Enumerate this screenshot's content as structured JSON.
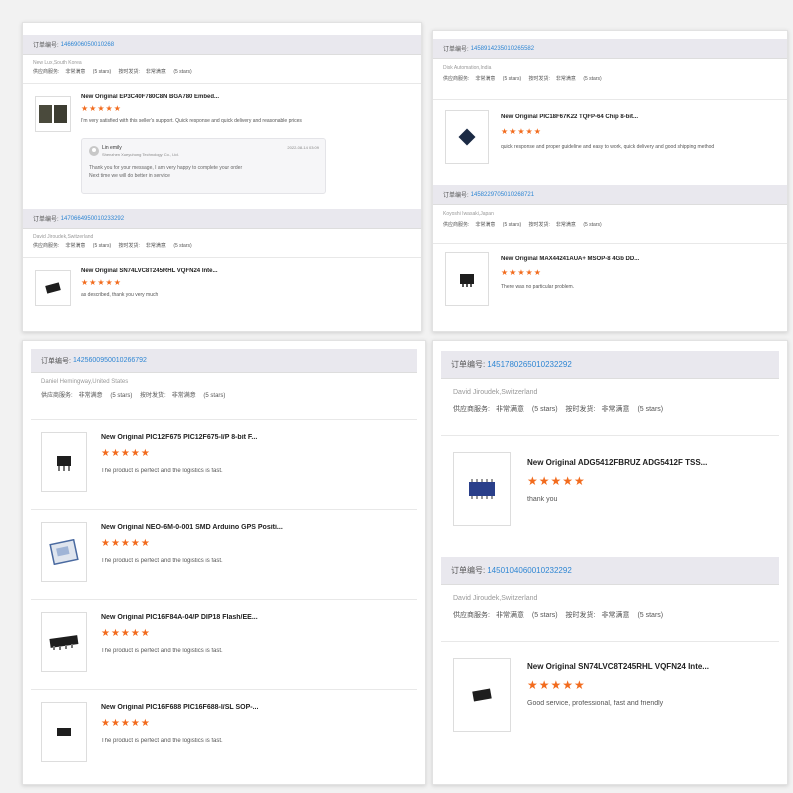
{
  "panel_a": {
    "order1": {
      "label": "订单编号:",
      "number": "1466906050010268",
      "buyer": "New Lux,South Korea",
      "service_label": "供应商服务:",
      "service_value": "非常满意",
      "service_stars": "(5 stars)",
      "ship_label": "按时发货:",
      "ship_value": "非常满意",
      "ship_stars": "(5 stars)",
      "item": {
        "title": "New Original EP3C40F780C8N BGA780 Embed...",
        "stars": "★★★★★",
        "comment": "I'm very satisfied with this seller's support. Quick response and quick delivery and reasonable prices",
        "reply": {
          "name": "Lin emily",
          "company": "Shenzhen Xueyuhong Technology Co., Ltd.",
          "date": "2022-08-14 03:09",
          "line1": "Thank you for your message, I am very happy to complete your order",
          "line2": "Next time we will do better in service"
        }
      }
    },
    "order2": {
      "label": "订单编号:",
      "number": "1470664950010233292",
      "buyer": "David Jiroudek,Switzerland",
      "service_label": "供应商服务:",
      "service_value": "非常满意",
      "service_stars": "(5 stars)",
      "ship_label": "按时发货:",
      "ship_value": "非常满意",
      "ship_stars": "(5 stars)",
      "item": {
        "title": "New Original SN74LVC8T245RHL VQFN24 Inte...",
        "stars": "★★★★★",
        "comment": "as described, thank you very much"
      }
    }
  },
  "panel_b": {
    "order1": {
      "label": "订单编号:",
      "number": "1458914235010265582",
      "buyer": "Disk Automation,India",
      "service_label": "供应商服务:",
      "service_value": "非常满意",
      "service_stars": "(5 stars)",
      "ship_label": "按时发货:",
      "ship_value": "非常满意",
      "ship_stars": "(5 stars)",
      "item": {
        "title": "New Original PIC18F67K22 TQFP-64 Chip 8-bit...",
        "stars": "★★★★★",
        "comment": "quick response and proper guideline and easy to work, quick delivery and good shipping method"
      }
    },
    "order2": {
      "label": "订单编号:",
      "number": "1458229705010268721",
      "buyer": "Koyoshi Iwasaki,Japan",
      "service_label": "供应商服务:",
      "service_value": "非常满意",
      "service_stars": "(5 stars)",
      "ship_label": "按时发货:",
      "ship_value": "非常满意",
      "ship_stars": "(5 stars)",
      "item": {
        "title": "New Original MAX44241AUA+ MSOP-8 4Gb DD...",
        "stars": "★★★★★",
        "comment": "There was no particular problem."
      }
    }
  },
  "panel_c": {
    "order1": {
      "label": "订单编号:",
      "number": "1425600950010266792",
      "buyer": "Daniel Hemingway,United States",
      "service_label": "供应商服务:",
      "service_value": "非常满意",
      "service_stars": "(5 stars)",
      "ship_label": "按时发货:",
      "ship_value": "非常满意",
      "ship_stars": "(5 stars)",
      "items": [
        {
          "title": "New Original PIC12F675 PIC12F675-I/P 8-bit F...",
          "stars": "★★★★★",
          "comment": "The product is perfect and the logistics is fast."
        },
        {
          "title": "New Original NEO-6M-0-001 SMD Arduino GPS Positi...",
          "stars": "★★★★★",
          "comment": "The product is perfect and the logistics is fast."
        },
        {
          "title": "New Original PIC16F84A-04/P DIP18 Flash/EE...",
          "stars": "★★★★★",
          "comment": "The product is perfect and the logistics is fast."
        },
        {
          "title": "New Original PIC16F688 PIC16F688-I/SL SOP-...",
          "stars": "★★★★★",
          "comment": "The product is perfect and the logistics is fast."
        }
      ]
    }
  },
  "panel_d": {
    "order1": {
      "label": "订单编号:",
      "number": "1451780265010232292",
      "buyer": "David Jiroudek,Switzerland",
      "service_label": "供应商服务:",
      "service_value": "非常满意",
      "service_stars": "(5 stars)",
      "ship_label": "按时发货:",
      "ship_value": "非常满意",
      "ship_stars": "(5 stars)",
      "item": {
        "title": "New Original ADG5412FBRUZ ADG5412F TSS...",
        "stars": "★★★★★",
        "comment": "thank you"
      }
    },
    "order2": {
      "label": "订单编号:",
      "number": "1450104060010232292",
      "buyer": "David Jiroudek,Switzerland",
      "service_label": "供应商服务:",
      "service_value": "非常满意",
      "service_stars": "(5 stars)",
      "ship_label": "按时发货:",
      "ship_value": "非常满意",
      "ship_stars": "(5 stars)",
      "item": {
        "title": "New Original SN74LVC8T245RHL VQFN24 Inte...",
        "stars": "★★★★★",
        "comment": "Good service, professional, fast and friendly"
      }
    }
  }
}
